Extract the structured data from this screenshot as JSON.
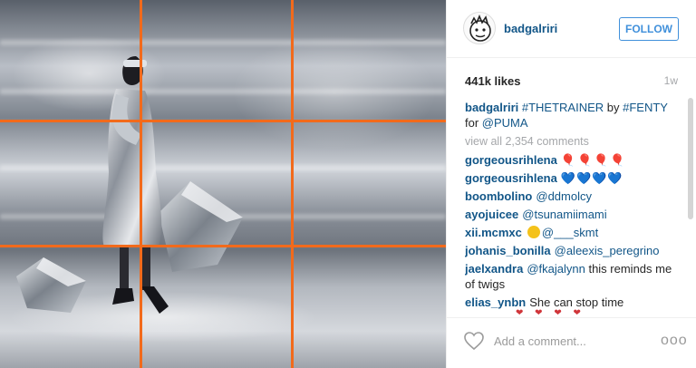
{
  "post": {
    "username": "badgalriri",
    "follow_label": "FOLLOW",
    "likes": "441k likes",
    "age": "1w",
    "caption": {
      "username": "badgalriri",
      "part1": "#THETRAINER",
      "part2": " by ",
      "part3": "#FENTY",
      "part4": " for ",
      "part5": "@PUMA"
    },
    "view_all": "view all 2,354 comments",
    "comments": [
      {
        "username": "gorgeousrihlena",
        "text": "🎈🎈🎈🎈",
        "kind": "balloon"
      },
      {
        "username": "gorgeousrihlena",
        "text": "💙💙💙💙",
        "kind": "heart"
      },
      {
        "username": "boombolino",
        "text": "@ddmolcy",
        "kind": "mention"
      },
      {
        "username": "ayojuicee",
        "text": "@tsunamiimami",
        "kind": "mention"
      },
      {
        "username": "xii.mcmxc",
        "text": "@___skmt",
        "kind": "smile"
      },
      {
        "username": "johanis_bonilla",
        "text": "@aleexis_peregrino",
        "kind": "mention"
      },
      {
        "username": "jaelxandra",
        "mention": "@fkajalynn",
        "text": " this reminds me of twigs",
        "kind": "mixed"
      },
      {
        "username": "elias_ynbn",
        "text": "She can stop time",
        "kind": "plain"
      }
    ],
    "partial_row": "❤ ❤ ❤ ❤",
    "add_comment_placeholder": "Add a comment...",
    "more_label": "ooo"
  },
  "colors": {
    "username": "#125688",
    "follow": "#4090db",
    "grid": "#f26a1b",
    "muted": "#a5a7aa"
  },
  "icons": [
    "avatar",
    "heart-icon",
    "more-options-icon"
  ]
}
